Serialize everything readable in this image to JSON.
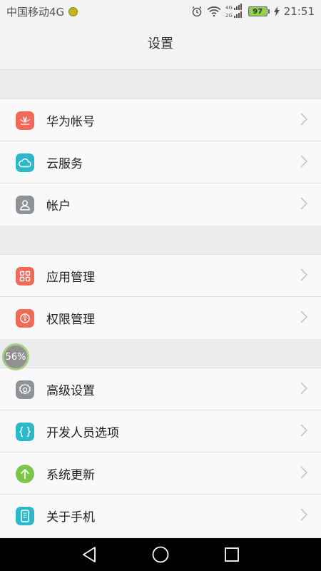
{
  "status": {
    "carrier": "中国移动4G",
    "time": "21:51",
    "battery": "97",
    "network_top": "4G",
    "network_bottom": "2G"
  },
  "header": {
    "title": "设置"
  },
  "sections": [
    {
      "items": [
        {
          "label": "华为帐号",
          "icon": "huawei-icon",
          "color": "#ef6a58"
        },
        {
          "label": "云服务",
          "icon": "cloud-icon",
          "color": "#2bb9c9"
        },
        {
          "label": "帐户",
          "icon": "user-icon",
          "color": "#8f9297"
        }
      ]
    },
    {
      "items": [
        {
          "label": "应用管理",
          "icon": "grid-icon",
          "color": "#ef6a58"
        },
        {
          "label": "权限管理",
          "icon": "key-icon",
          "color": "#ef6a58"
        }
      ]
    },
    {
      "items": [
        {
          "label": "高级设置",
          "icon": "gear-icon",
          "color": "#8f9297"
        },
        {
          "label": "开发人员选项",
          "icon": "braces-icon",
          "color": "#2bb9c9"
        },
        {
          "label": "系统更新",
          "icon": "arrow-up-icon",
          "color": "#7cc44b"
        },
        {
          "label": "关于手机",
          "icon": "phone-icon",
          "color": "#2bb9c9"
        }
      ]
    }
  ],
  "floating_badge": {
    "text": "56%"
  }
}
